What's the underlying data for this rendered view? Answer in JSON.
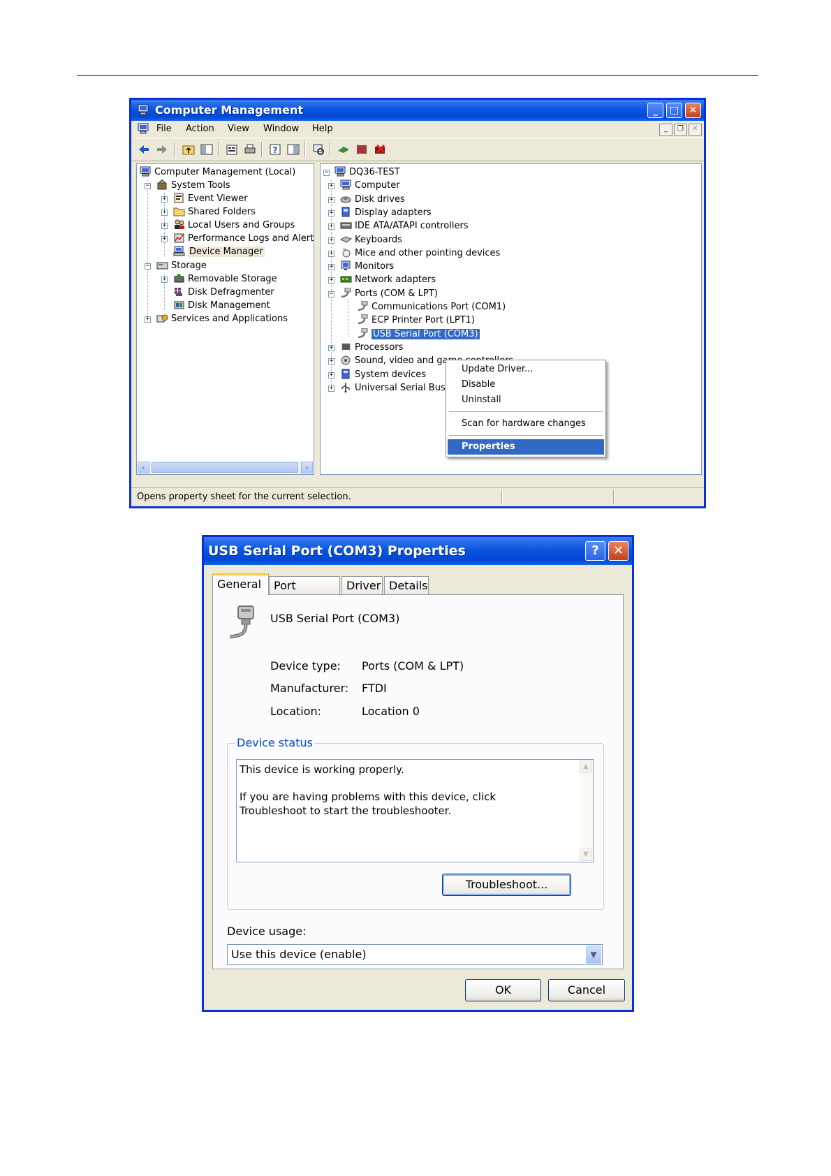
{
  "cm": {
    "title": "Computer Management",
    "menu": [
      "File",
      "Action",
      "View",
      "Window",
      "Help"
    ],
    "left_tree": [
      {
        "label": "Computer Management (Local)",
        "level": 0,
        "toggle": "",
        "icon": "computer-icon"
      },
      {
        "label": "System Tools",
        "level": 1,
        "toggle": "−",
        "icon": "tools-icon"
      },
      {
        "label": "Event Viewer",
        "level": 2,
        "toggle": "+",
        "icon": "event-viewer-icon"
      },
      {
        "label": "Shared Folders",
        "level": 2,
        "toggle": "+",
        "icon": "folder-icon"
      },
      {
        "label": "Local Users and Groups",
        "level": 2,
        "toggle": "+",
        "icon": "users-icon"
      },
      {
        "label": "Performance Logs and Alerts",
        "level": 2,
        "toggle": "+",
        "icon": "performance-icon"
      },
      {
        "label": "Device Manager",
        "level": 2,
        "toggle": "",
        "icon": "device-manager-icon",
        "selected": true
      },
      {
        "label": "Storage",
        "level": 1,
        "toggle": "−",
        "icon": "storage-icon"
      },
      {
        "label": "Removable Storage",
        "level": 2,
        "toggle": "+",
        "icon": "removable-storage-icon"
      },
      {
        "label": "Disk Defragmenter",
        "level": 2,
        "toggle": "",
        "icon": "defragmenter-icon"
      },
      {
        "label": "Disk Management",
        "level": 2,
        "toggle": "",
        "icon": "disk-management-icon"
      },
      {
        "label": "Services and Applications",
        "level": 1,
        "toggle": "+",
        "icon": "services-icon"
      }
    ],
    "right_tree": [
      {
        "label": "DQ36-TEST",
        "level": 0,
        "toggle": "−",
        "icon": "computer-icon"
      },
      {
        "label": "Computer",
        "level": 1,
        "toggle": "+",
        "icon": "computer-icon"
      },
      {
        "label": "Disk drives",
        "level": 1,
        "toggle": "+",
        "icon": "disk-drive-icon"
      },
      {
        "label": "Display adapters",
        "level": 1,
        "toggle": "+",
        "icon": "display-icon"
      },
      {
        "label": "IDE ATA/ATAPI controllers",
        "level": 1,
        "toggle": "+",
        "icon": "ide-controller-icon"
      },
      {
        "label": "Keyboards",
        "level": 1,
        "toggle": "+",
        "icon": "keyboard-icon"
      },
      {
        "label": "Mice and other pointing devices",
        "level": 1,
        "toggle": "+",
        "icon": "mouse-icon"
      },
      {
        "label": "Monitors",
        "level": 1,
        "toggle": "+",
        "icon": "monitor-icon"
      },
      {
        "label": "Network adapters",
        "level": 1,
        "toggle": "+",
        "icon": "network-adapter-icon"
      },
      {
        "label": "Ports (COM & LPT)",
        "level": 1,
        "toggle": "−",
        "icon": "port-icon"
      },
      {
        "label": "Communications Port (COM1)",
        "level": 2,
        "toggle": "",
        "icon": "port-icon"
      },
      {
        "label": "ECP Printer Port (LPT1)",
        "level": 2,
        "toggle": "",
        "icon": "port-icon"
      },
      {
        "label": "USB Serial Port (COM3)",
        "level": 2,
        "toggle": "",
        "icon": "port-icon",
        "selected": true
      },
      {
        "label": "Processors",
        "level": 1,
        "toggle": "+",
        "icon": "processor-icon"
      },
      {
        "label": "Sound, video and game controllers",
        "level": 1,
        "toggle": "+",
        "icon": "sound-icon"
      },
      {
        "label": "System devices",
        "level": 1,
        "toggle": "+",
        "icon": "system-devices-icon"
      },
      {
        "label": "Universal Serial Bus controllers",
        "level": 1,
        "toggle": "+",
        "icon": "usb-icon"
      }
    ],
    "context_menu": {
      "update_driver": "Update Driver...",
      "disable": "Disable",
      "uninstall": "Uninstall",
      "scan": "Scan for hardware changes",
      "properties": "Properties"
    },
    "status_text": "Opens property sheet for the current selection."
  },
  "dlg": {
    "title": "USB Serial Port (COM3) Properties",
    "tabs": [
      "General",
      "Port Settings",
      "Driver",
      "Details"
    ],
    "device_name": "USB Serial Port (COM3)",
    "device_type_label": "Device type:",
    "device_type_value": "Ports (COM & LPT)",
    "manufacturer_label": "Manufacturer:",
    "manufacturer_value": "FTDI",
    "location_label": "Location:",
    "location_value": "Location 0",
    "device_status_title": "Device status",
    "status_line1": "This device is working properly.",
    "status_line2": "If you are having problems with this device, click Troubleshoot to start the troubleshooter.",
    "troubleshoot_button": "Troubleshoot...",
    "device_usage_label": "Device usage:",
    "device_usage_value": "Use this device (enable)",
    "ok_button": "OK",
    "cancel_button": "Cancel"
  }
}
